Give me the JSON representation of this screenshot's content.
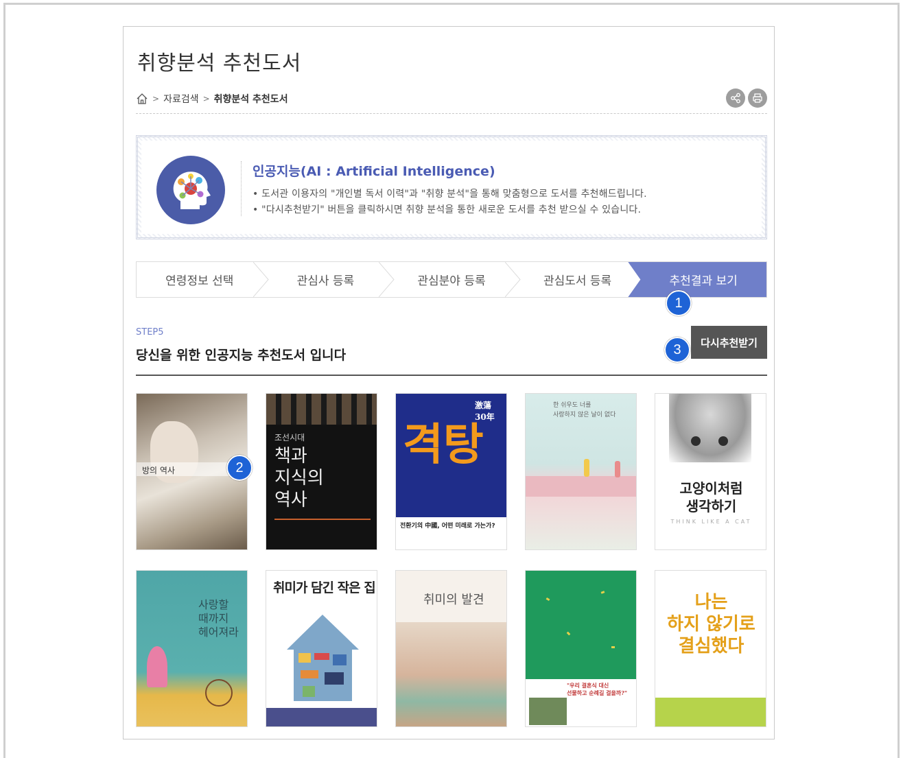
{
  "page": {
    "title": "취향분석 추천도서",
    "breadcrumb": {
      "sep": ">",
      "level1": "자료검색",
      "current": "취향분석 추천도서"
    }
  },
  "ai_box": {
    "heading": "인공지능(AI : Artificial Intelligence)",
    "line1": "• 도서관 이용자의 \"개인별 독서 이력\"과 \"취향 분석\"을 통해 맞춤형으로 도서를 추천해드립니다.",
    "line2": "• \"다시추천받기\" 버튼을 클릭하시면 취향 분석을 통한 새로운 도서를 추천 받으실 수 있습니다."
  },
  "steps": [
    {
      "label": "연령정보 선택"
    },
    {
      "label": "관심사 등록"
    },
    {
      "label": "관심분야 등록"
    },
    {
      "label": "관심도서 등록"
    },
    {
      "label": "추천결과 보기"
    }
  ],
  "section": {
    "step_label": "STEP5",
    "title": "당신을 위한 인공지능 추천도서 입니다",
    "retry_button": "다시추천받기"
  },
  "badges": {
    "b1": "1",
    "b2": "2",
    "b3": "3"
  },
  "books": [
    {
      "cover_title": "방의 역사"
    },
    {
      "cover_top": "조선시대",
      "cover_title": "책과\n지식의\n역사"
    },
    {
      "cover_top": "激蕩\n30年",
      "cover_title": "격탕",
      "cover_sub": "전환기의 中國, 어떤 미래로 가는가?"
    },
    {
      "cover_title": "한 쉬우도 너를\n사랑하지 않은 날이 없다"
    },
    {
      "cover_title": "고양이처럼\n생각하기",
      "cover_sub": "THINK LIKE A CAT"
    },
    {
      "cover_title": "사랑할\n때까지\n헤어져라"
    },
    {
      "cover_title": "취미가 담긴 작은 집"
    },
    {
      "cover_title": "취미의 발견"
    },
    {
      "cover_title": "\"우리 결혼식 대신\n선물하고 순례길 걸을까?\""
    },
    {
      "cover_title": "나는\n하지 않기로\n결심했다"
    }
  ],
  "colors": {
    "accent": "#6f7fc9",
    "badge": "#1e63d6",
    "heading": "#4a5bb3"
  }
}
